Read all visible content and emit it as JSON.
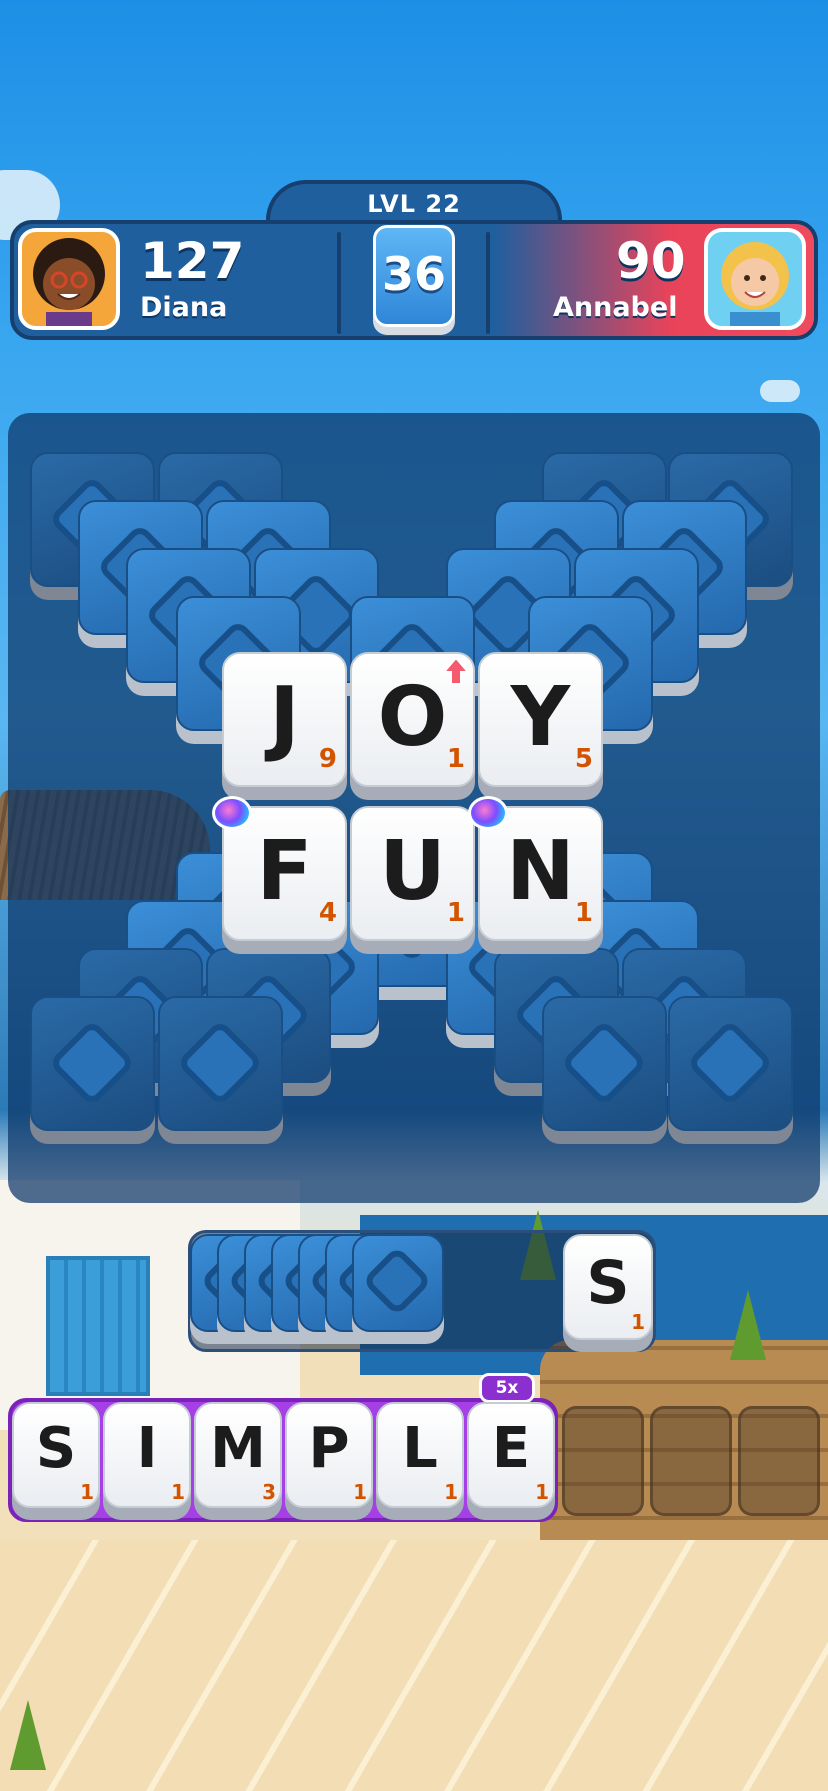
{
  "hud": {
    "level_label": "LVL 22",
    "moves_left": "36",
    "player_left": {
      "name": "Diana",
      "score": "127",
      "avatar_icon": "diana-avatar-icon"
    },
    "player_right": {
      "name": "Annabel",
      "score": "90",
      "avatar_icon": "annabel-avatar-icon"
    }
  },
  "board": {
    "rows": [
      [
        {
          "letter": "J",
          "points": "9",
          "badge": ""
        },
        {
          "letter": "O",
          "points": "1",
          "badge": "arrow-up-icon"
        },
        {
          "letter": "Y",
          "points": "5",
          "badge": ""
        }
      ],
      [
        {
          "letter": "F",
          "points": "4",
          "badge": "candy-icon"
        },
        {
          "letter": "U",
          "points": "1",
          "badge": ""
        },
        {
          "letter": "N",
          "points": "1",
          "badge": "candy-icon"
        }
      ]
    ]
  },
  "queue": {
    "hidden_tiles": 7,
    "next_tile": {
      "letter": "S",
      "points": "1"
    }
  },
  "rack": {
    "multiplier": "5x",
    "tiles": [
      {
        "letter": "S",
        "points": "1"
      },
      {
        "letter": "I",
        "points": "1"
      },
      {
        "letter": "M",
        "points": "3"
      },
      {
        "letter": "P",
        "points": "1"
      },
      {
        "letter": "L",
        "points": "1"
      },
      {
        "letter": "E",
        "points": "1"
      }
    ],
    "empty_slots": 3
  },
  "colors": {
    "rack_purple": "#a53fe6",
    "opponent_red": "#e8435a",
    "points_orange": "#d35400",
    "tile_blue": "#2f86d8"
  }
}
